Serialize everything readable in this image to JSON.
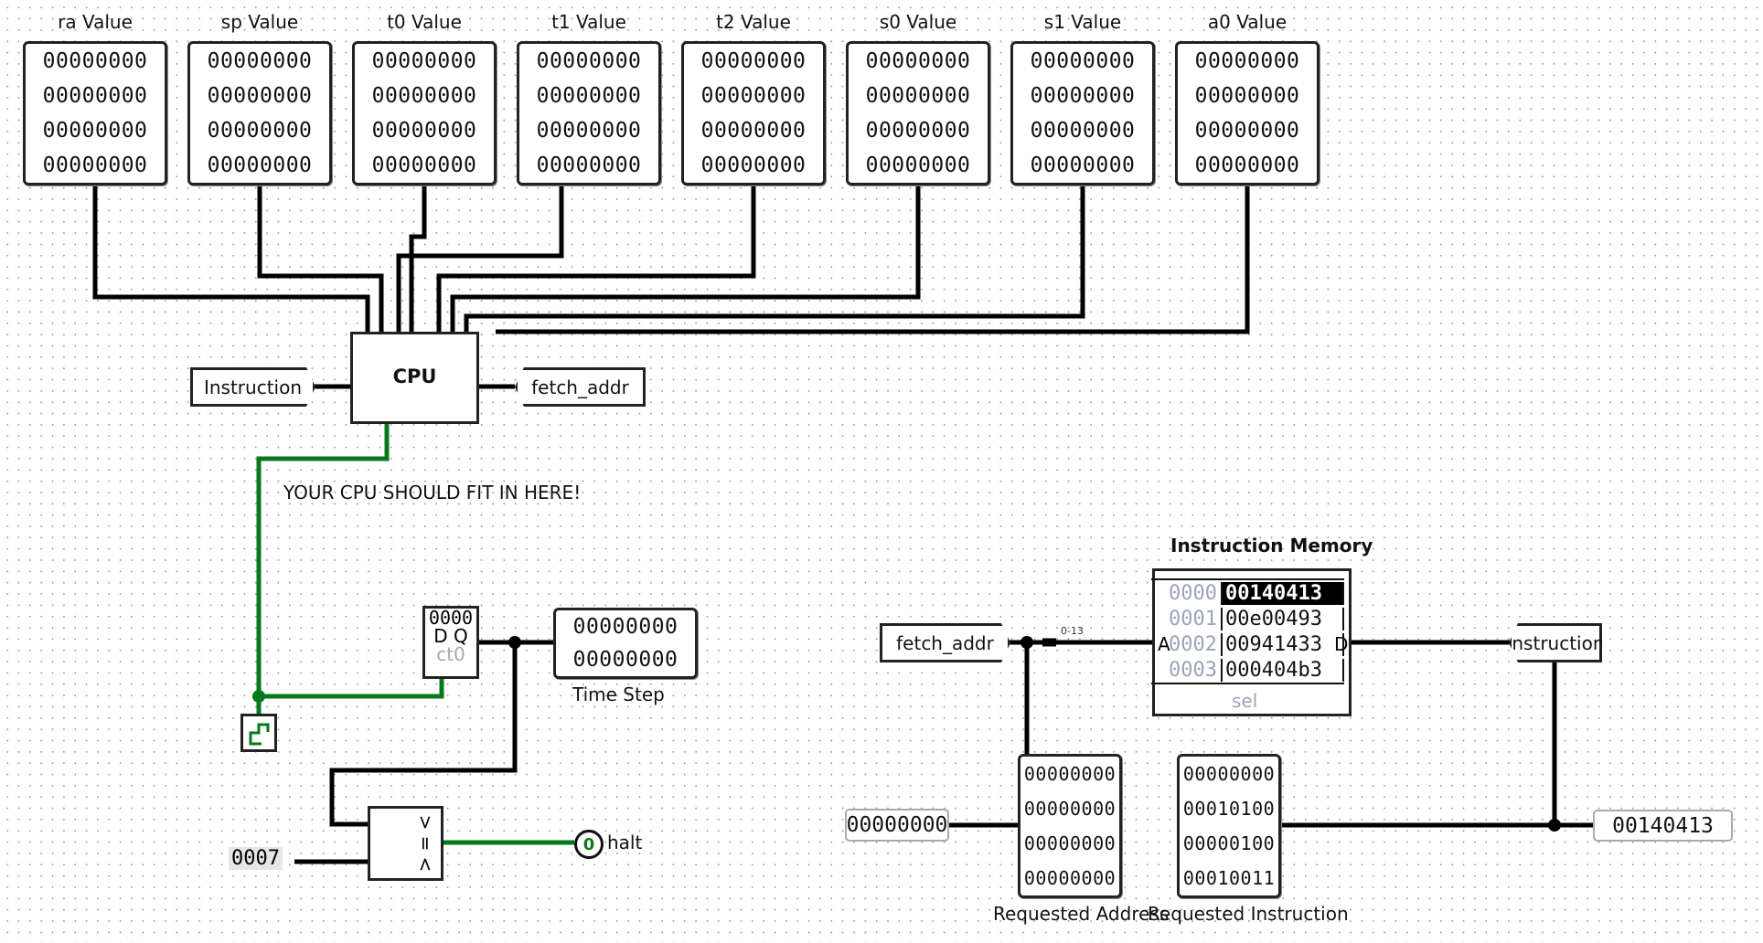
{
  "registers": [
    {
      "name": "ra Value",
      "rows": [
        "00000000",
        "00000000",
        "00000000",
        "00000000"
      ]
    },
    {
      "name": "sp Value",
      "rows": [
        "00000000",
        "00000000",
        "00000000",
        "00000000"
      ]
    },
    {
      "name": "t0 Value",
      "rows": [
        "00000000",
        "00000000",
        "00000000",
        "00000000"
      ]
    },
    {
      "name": "t1 Value",
      "rows": [
        "00000000",
        "00000000",
        "00000000",
        "00000000"
      ]
    },
    {
      "name": "t2 Value",
      "rows": [
        "00000000",
        "00000000",
        "00000000",
        "00000000"
      ]
    },
    {
      "name": "s0 Value",
      "rows": [
        "00000000",
        "00000000",
        "00000000",
        "00000000"
      ]
    },
    {
      "name": "s1 Value",
      "rows": [
        "00000000",
        "00000000",
        "00000000",
        "00000000"
      ]
    },
    {
      "name": "a0 Value",
      "rows": [
        "00000000",
        "00000000",
        "00000000",
        "00000000"
      ]
    }
  ],
  "cpu": {
    "label": "CPU",
    "input_tunnel": "Instruction",
    "output_tunnel": "fetch_addr",
    "note": "YOUR CPU SHOULD FIT IN HERE!"
  },
  "timer": {
    "register_value": "0000",
    "register_pins": "D Q",
    "register_ctrl": "ct0",
    "display_rows": [
      "00000000",
      "00000000"
    ],
    "display_label": "Time Step",
    "constant": "0007",
    "comparator_symbols": [
      ">",
      "=",
      "<"
    ],
    "halt_led_value": "0",
    "halt_label": "halt"
  },
  "memory": {
    "title": "Instruction Memory",
    "input_tunnel": "fetch_addr",
    "splitter_label": "0-13",
    "port_a": "A",
    "port_d": "D",
    "sel_label": "sel",
    "rows": [
      {
        "addr": "0000",
        "value": "00140413",
        "selected": true
      },
      {
        "addr": "0001",
        "value": "00e00493",
        "selected": false
      },
      {
        "addr": "0002",
        "value": "00941433",
        "selected": false
      },
      {
        "addr": "0003",
        "value": "000404b3",
        "selected": false
      }
    ],
    "output_tunnel": "Instruction",
    "address_pin": "00000000",
    "requested_address_rows": [
      "00000000",
      "00000000",
      "00000000",
      "00000000"
    ],
    "requested_address_label": "Requested Address",
    "requested_instruction_rows": [
      "00000000",
      "00010100",
      "00000100",
      "00010011"
    ],
    "requested_instruction_label": "Requested Instruction",
    "instruction_pin": "00140413"
  },
  "colors": {
    "wire": "#000000",
    "active_wire": "#067a1a",
    "selected_bg": "#000000"
  }
}
